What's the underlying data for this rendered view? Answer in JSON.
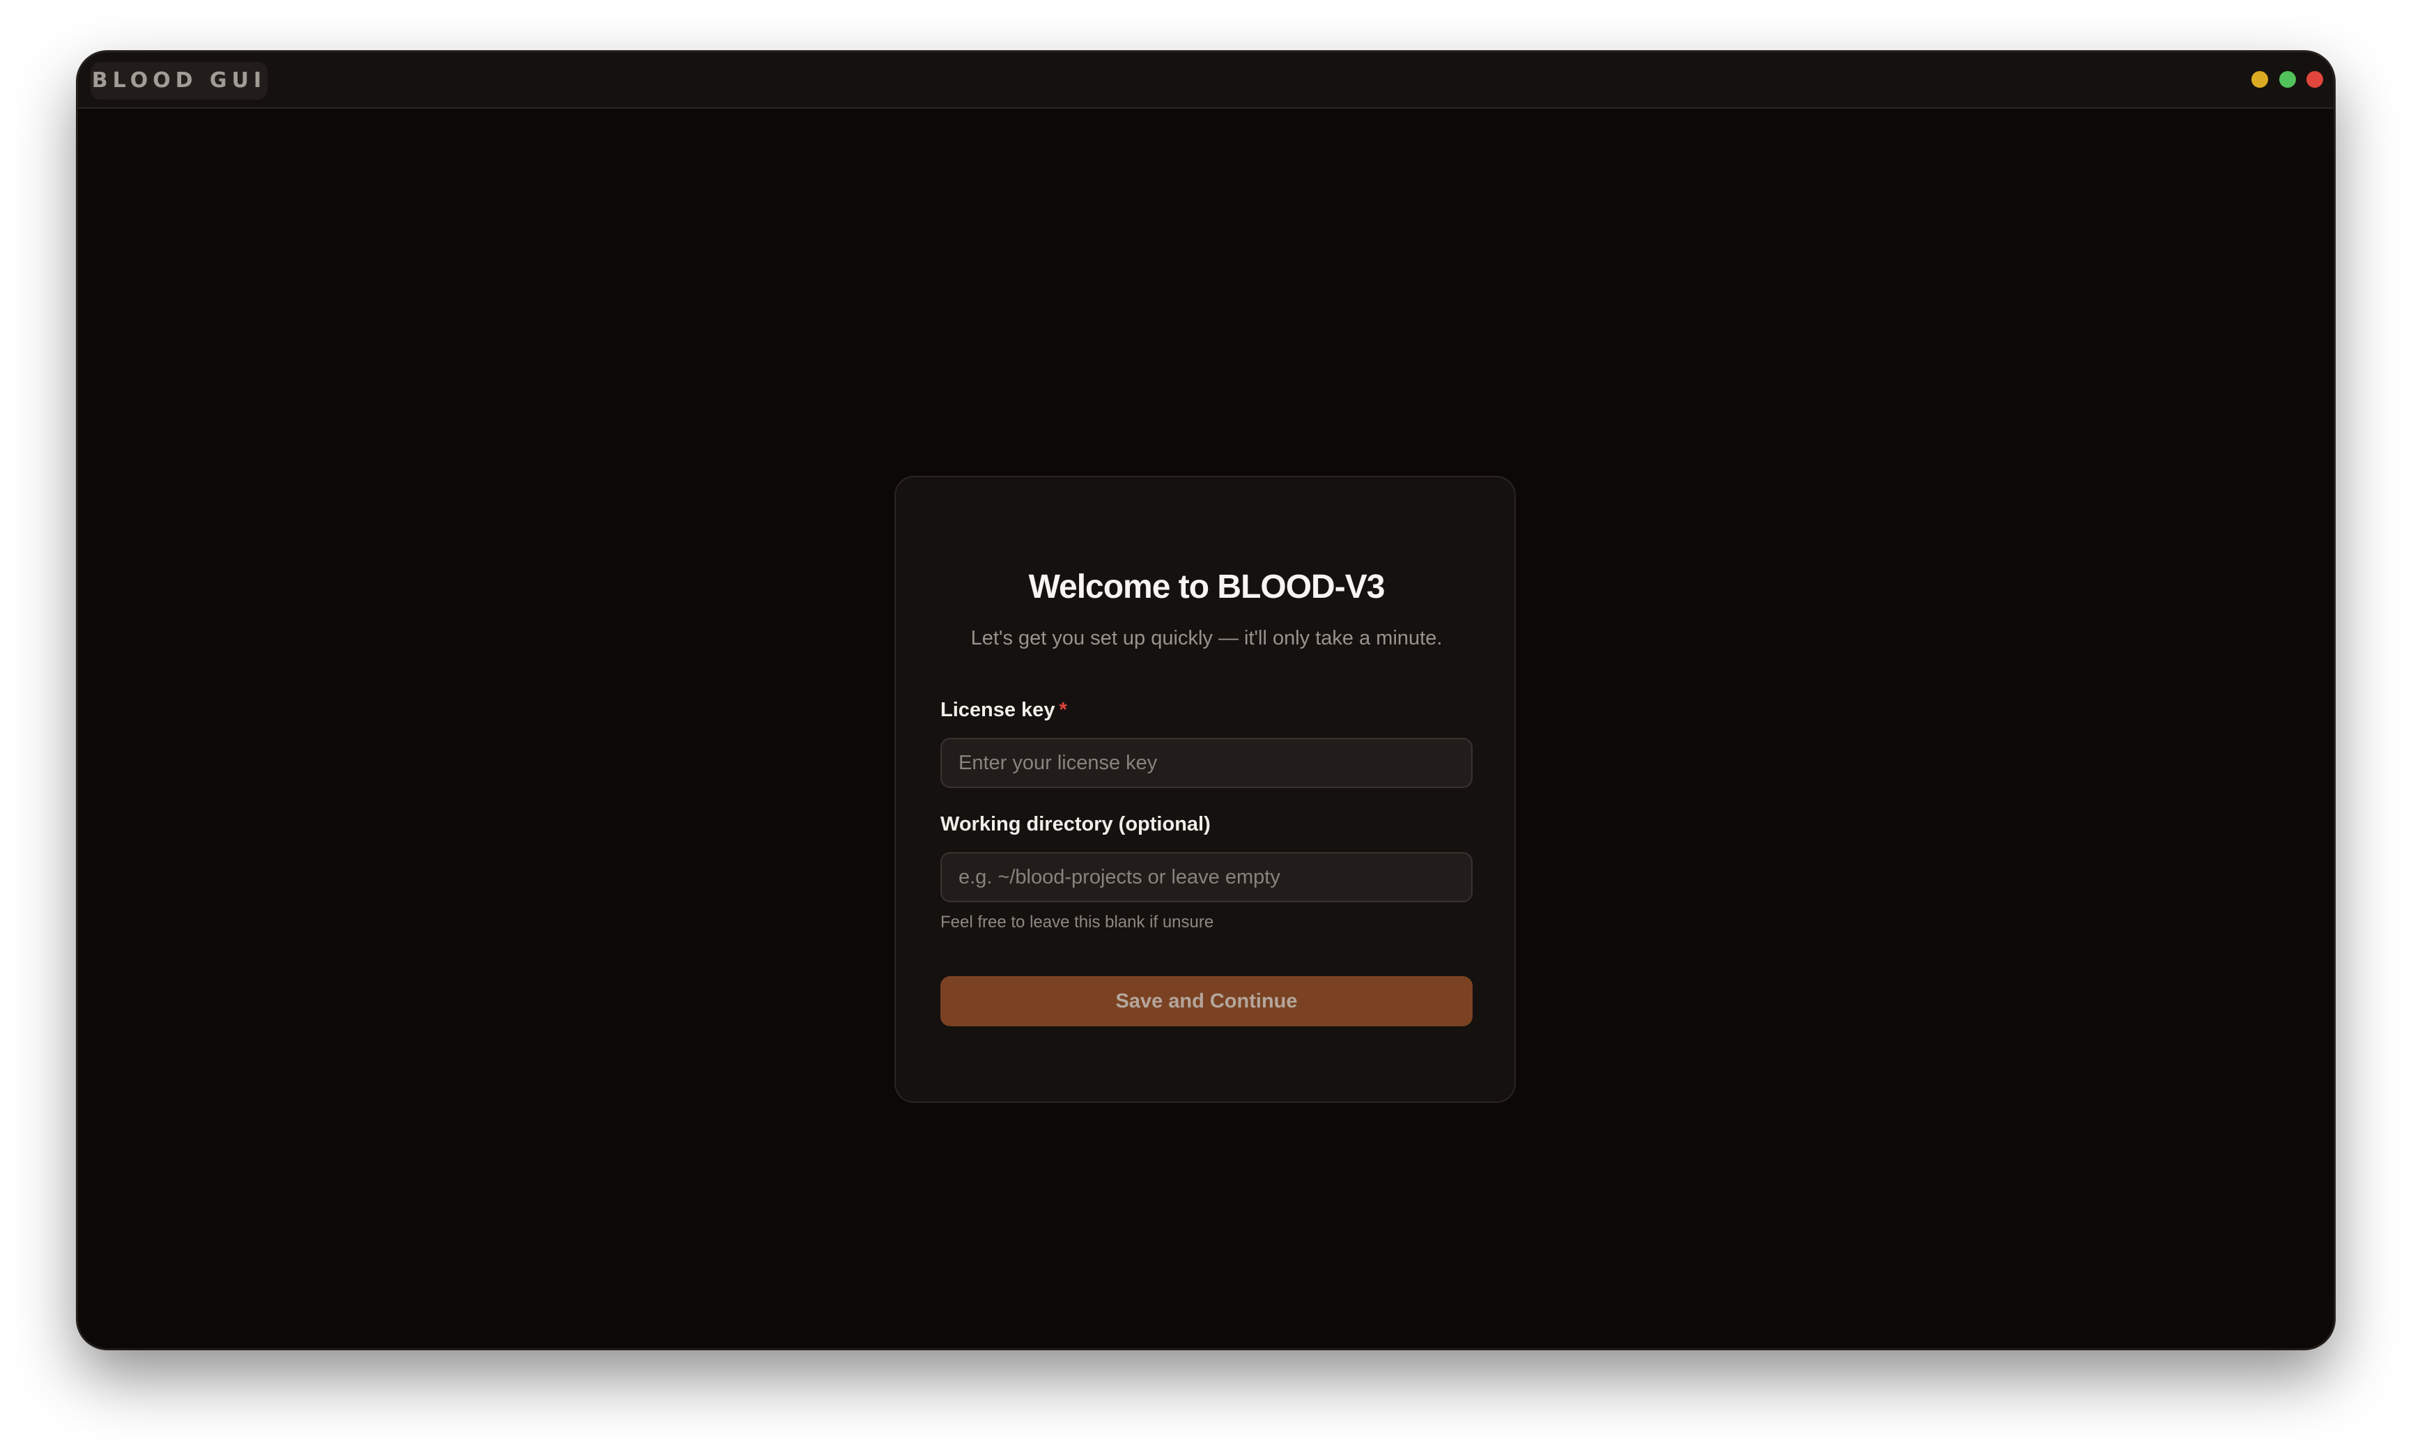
{
  "app": {
    "tag": "BLOOD GUI"
  },
  "window_controls": {
    "minimize_color": "#dcaa22",
    "maximize_color": "#52c25a",
    "close_color": "#e0463c"
  },
  "setup": {
    "title": "Welcome to BLOOD-V3",
    "subtitle": "Let's get you set up quickly — it'll only take a minute.",
    "license": {
      "label": "License key",
      "required_marker": "*",
      "value": "",
      "placeholder": "Enter your license key"
    },
    "workdir": {
      "label": "Working directory (optional)",
      "value": "",
      "placeholder": "e.g. ~/blood-projects or leave empty",
      "hint": "Feel free to leave this blank if unsure"
    },
    "submit_label": "Save and Continue"
  },
  "colors": {
    "accent": "#7a4222",
    "background": "#0b0806",
    "card": "#15110f",
    "required": "#e0463c"
  }
}
